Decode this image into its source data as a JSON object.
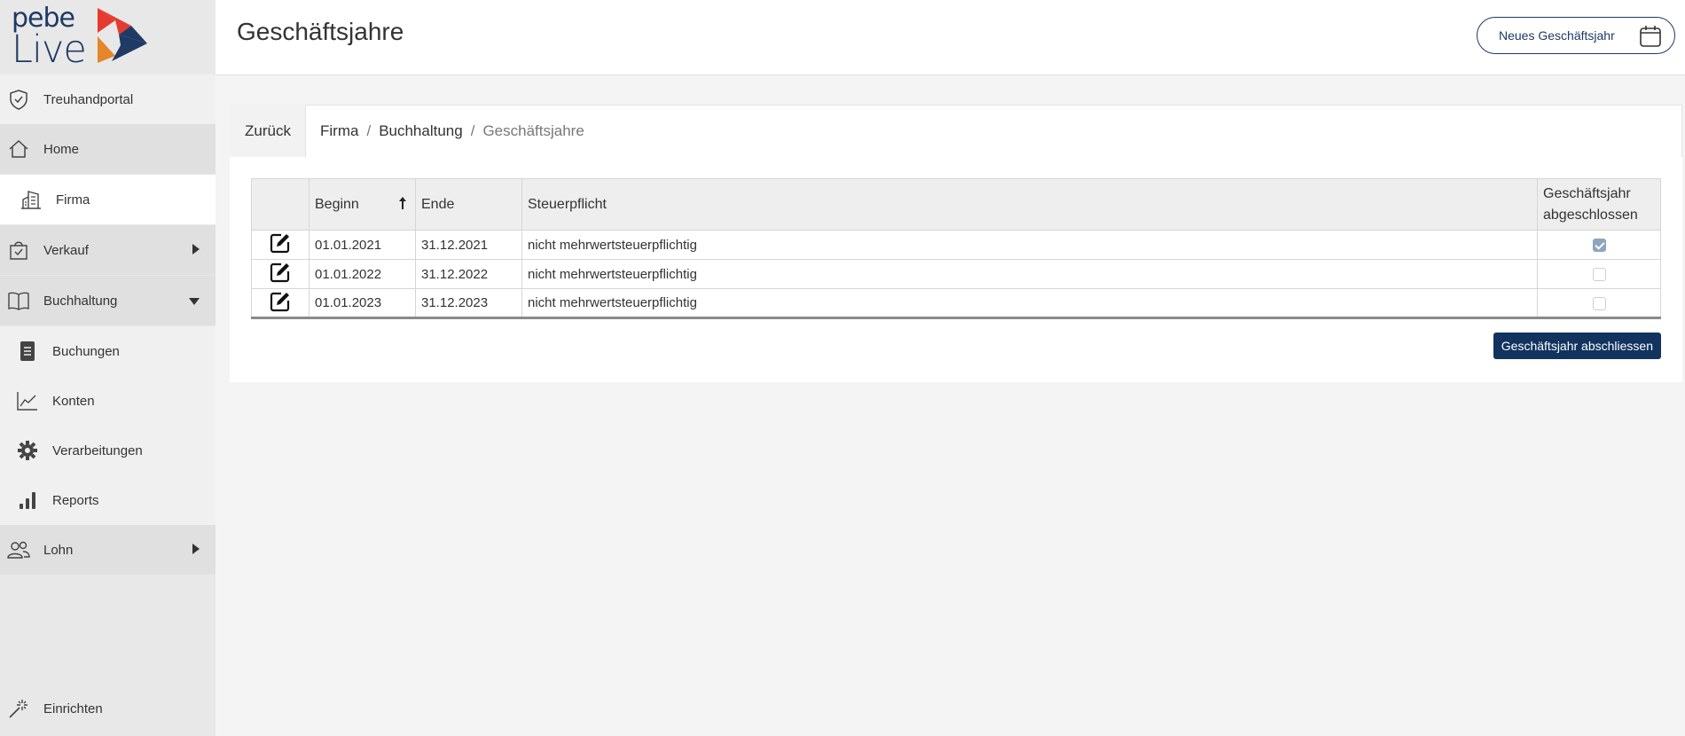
{
  "brand": {
    "line1": "pebe",
    "line2": "Live"
  },
  "colors": {
    "primary": "#11335e",
    "logo_red": "#e63a2e",
    "logo_orange": "#e5862a",
    "logo_navy": "#1f3a64"
  },
  "sidebar": {
    "items": [
      {
        "label": "Treuhandportal",
        "icon": "shield-check-icon"
      },
      {
        "label": "Home",
        "icon": "home-icon"
      },
      {
        "label": "Firma",
        "icon": "building-icon"
      },
      {
        "label": "Verkauf",
        "icon": "shopping-bag-icon"
      },
      {
        "label": "Buchhaltung",
        "icon": "book-icon"
      },
      {
        "label": "Buchungen",
        "icon": "document-icon"
      },
      {
        "label": "Konten",
        "icon": "line-chart-icon"
      },
      {
        "label": "Verarbeitungen",
        "icon": "gear-icon"
      },
      {
        "label": "Reports",
        "icon": "bar-chart-icon"
      },
      {
        "label": "Lohn",
        "icon": "users-icon"
      },
      {
        "label": "Einrichten",
        "icon": "magic-wand-icon"
      }
    ]
  },
  "header": {
    "title": "Geschäftsjahre",
    "new_button": "Neues Geschäftsjahr"
  },
  "breadcrumb": {
    "back": "Zurück",
    "items": [
      "Firma",
      "Buchhaltung",
      "Geschäftsjahre"
    ]
  },
  "table": {
    "columns": {
      "beginn": "Beginn",
      "ende": "Ende",
      "steuerpflicht": "Steuerpflicht",
      "abgeschlossen_1": "Geschäftsjahr",
      "abgeschlossen_2": "abgeschlossen"
    },
    "sort": {
      "column": "Beginn",
      "direction": "ascending"
    },
    "rows": [
      {
        "beginn": "01.01.2021",
        "ende": "31.12.2021",
        "steuerpflicht": "nicht mehrwertsteuerpflichtig",
        "abgeschlossen": true
      },
      {
        "beginn": "01.01.2022",
        "ende": "31.12.2022",
        "steuerpflicht": "nicht mehrwertsteuerpflichtig",
        "abgeschlossen": false
      },
      {
        "beginn": "01.01.2023",
        "ende": "31.12.2023",
        "steuerpflicht": "nicht mehrwertsteuerpflichtig",
        "abgeschlossen": false
      }
    ]
  },
  "actions": {
    "close_year": "Geschäftsjahr abschliessen"
  }
}
